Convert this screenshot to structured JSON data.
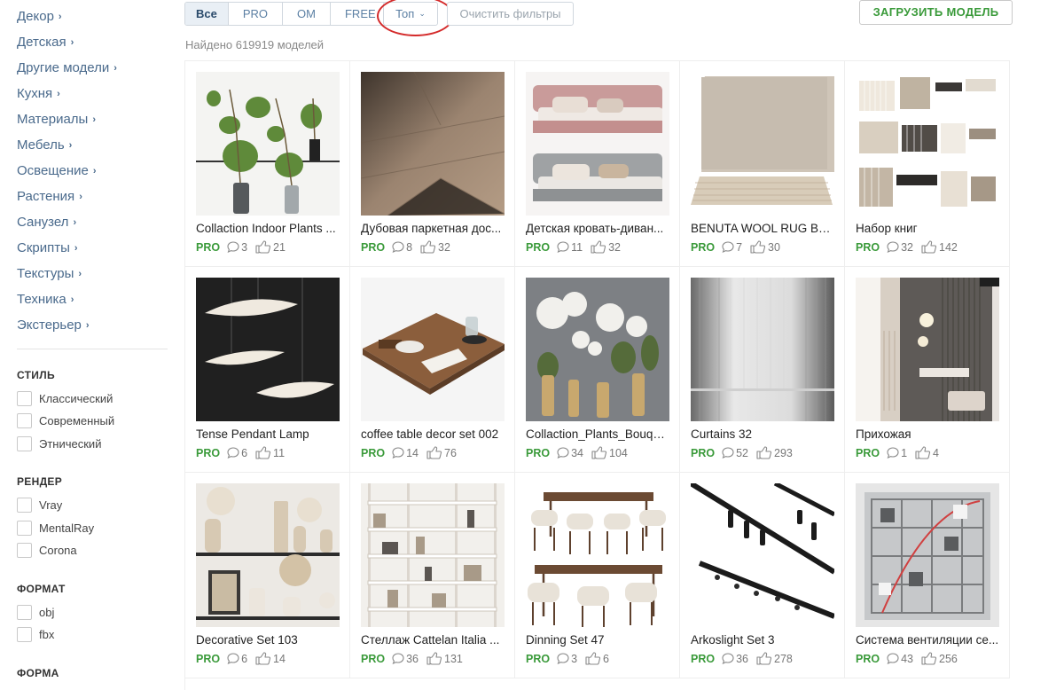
{
  "sidebar": {
    "categories": [
      {
        "label": "Декор"
      },
      {
        "label": "Детская"
      },
      {
        "label": "Другие модели"
      },
      {
        "label": "Кухня"
      },
      {
        "label": "Материалы"
      },
      {
        "label": "Мебель"
      },
      {
        "label": "Освещение"
      },
      {
        "label": "Растения"
      },
      {
        "label": "Санузел"
      },
      {
        "label": "Скрипты"
      },
      {
        "label": "Текстуры"
      },
      {
        "label": "Техника"
      },
      {
        "label": "Экстерьер"
      }
    ],
    "style_title": "СТИЛЬ",
    "style_options": [
      "Классический",
      "Современный",
      "Этнический"
    ],
    "render_title": "РЕНДЕР",
    "render_options": [
      "Vray",
      "MentalRay",
      "Corona"
    ],
    "format_title": "ФОРМАТ",
    "format_options": [
      "obj",
      "fbx"
    ],
    "shape_title": "ФОРМА"
  },
  "filters": {
    "segments": [
      "Все",
      "PRO",
      "OM",
      "FREE"
    ],
    "active_segment": "Все",
    "sort_label": "Топ",
    "clear_label": "Очистить фильтры",
    "upload_label": "ЗАГРУЗИТЬ МОДЕЛЬ",
    "found_text": "Найдено 619919 моделей",
    "highlight_color": "#d42a2a"
  },
  "models": [
    {
      "title": "Collaction Indoor Plants ...",
      "badge": "PRO",
      "comments": "3",
      "likes": "21",
      "thumb": "plants-vases"
    },
    {
      "title": "Дубовая паркетная дос...",
      "badge": "PRO",
      "comments": "8",
      "likes": "32",
      "thumb": "parquet"
    },
    {
      "title": "Детская кровать-диван...",
      "badge": "PRO",
      "comments": "11",
      "likes": "32",
      "thumb": "sofa-beds"
    },
    {
      "title": "BENUTA WOOL RUG BEA...",
      "badge": "PRO",
      "comments": "7",
      "likes": "30",
      "thumb": "rug"
    },
    {
      "title": "Набор книг",
      "badge": "PRO",
      "comments": "32",
      "likes": "142",
      "thumb": "books"
    },
    {
      "title": "Tense Pendant Lamp",
      "badge": "PRO",
      "comments": "6",
      "likes": "11",
      "thumb": "pendant-lamp"
    },
    {
      "title": "coffee table decor set 002",
      "badge": "PRO",
      "comments": "14",
      "likes": "76",
      "thumb": "table-decor"
    },
    {
      "title": "Collaction_Plants_Bouqu...",
      "badge": "PRO",
      "comments": "34",
      "likes": "104",
      "thumb": "bouquets"
    },
    {
      "title": "Curtains 32",
      "badge": "PRO",
      "comments": "52",
      "likes": "293",
      "thumb": "curtains"
    },
    {
      "title": "Прихожая",
      "badge": "PRO",
      "comments": "1",
      "likes": "4",
      "thumb": "hallway"
    },
    {
      "title": "Decorative Set 103",
      "badge": "PRO",
      "comments": "6",
      "likes": "14",
      "thumb": "decor-set"
    },
    {
      "title": "Стеллаж Cattelan Italia ...",
      "badge": "PRO",
      "comments": "36",
      "likes": "131",
      "thumb": "shelving"
    },
    {
      "title": "Dinning Set 47",
      "badge": "PRO",
      "comments": "3",
      "likes": "6",
      "thumb": "dining-set"
    },
    {
      "title": "Arkoslight Set 3",
      "badge": "PRO",
      "comments": "36",
      "likes": "278",
      "thumb": "track-lights"
    },
    {
      "title": "Система вентиляции се...",
      "badge": "PRO",
      "comments": "43",
      "likes": "256",
      "thumb": "ventilation"
    }
  ]
}
